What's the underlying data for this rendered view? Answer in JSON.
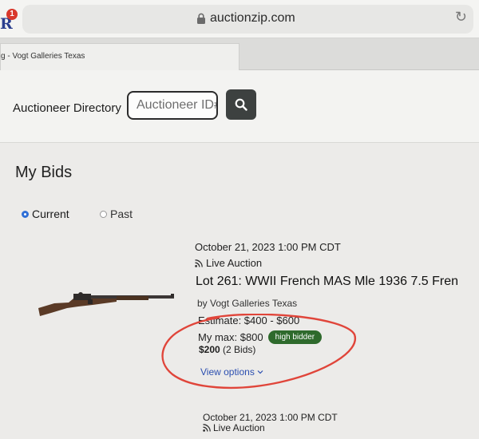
{
  "browser": {
    "extension_badge": "1",
    "extension_letter": "R",
    "url": "auctionzip.com",
    "tab_title": "g - Vogt Galleries Texas"
  },
  "header": {
    "directory_label": "Auctioneer Directory",
    "id_placeholder": "Auctioneer ID#"
  },
  "main": {
    "title": "My Bids",
    "filters": [
      {
        "label": "Current",
        "selected": true
      },
      {
        "label": "Past",
        "selected": false
      }
    ],
    "bids": [
      {
        "date": "October 21, 2023 1:00 PM CDT",
        "auction_type": "Live Auction",
        "lot_title": "Lot 261: WWII French MAS Mle 1936 7.5 Fren",
        "seller": "by Vogt Galleries Texas",
        "estimate": "Estimate: $400 - $600",
        "my_max": "My max: $800",
        "status_badge": "high bidder",
        "current_bid": "$200",
        "bid_count": "(2 Bids)",
        "view_options": "View options"
      },
      {
        "date": "October 21, 2023 1:00 PM CDT",
        "auction_type": "Live Auction"
      }
    ]
  },
  "colors": {
    "accent_blue": "#2f6fd6",
    "badge_green": "#2e6a2c",
    "link_blue": "#2c4fb0",
    "annotation_red": "#e0453a"
  }
}
